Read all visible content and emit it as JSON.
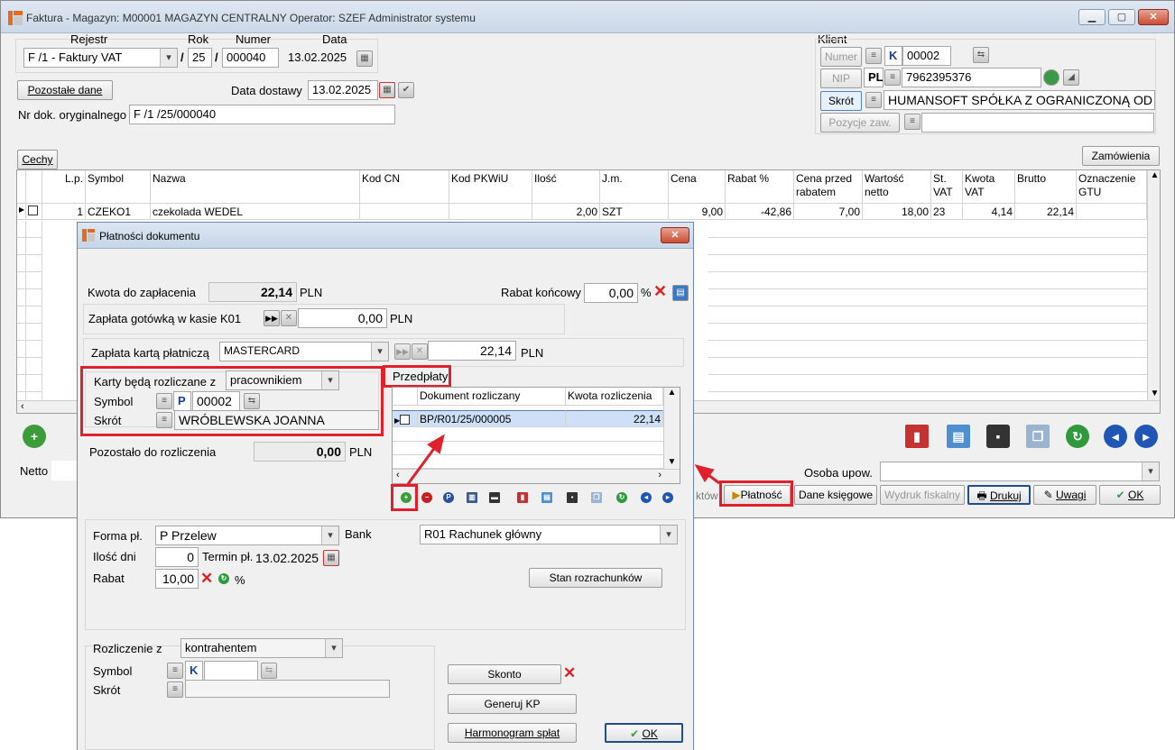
{
  "window": {
    "title": "Faktura - Magazyn: M00001 MAGAZYN CENTRALNY  Operator: SZEF Administrator systemu"
  },
  "header": {
    "rejestr_label": "Rejestr",
    "rok_label": "Rok",
    "numer_label": "Numer",
    "data_label": "Data",
    "rejestr": "F /1  - Faktury VAT",
    "rok": "25",
    "numer": "000040",
    "data": "13.02.2025",
    "pozostale_dane": "Pozostałe dane",
    "data_dostawy_label": "Data dostawy",
    "data_dostawy": "13.02.2025",
    "nr_dok_label": "Nr dok. oryginalnego",
    "nr_dok": "F /1  /25/000040"
  },
  "klient": {
    "label": "Klient",
    "numer_btn": "Numer",
    "numer_prefix": "K",
    "numer": "00002",
    "nip_btn": "NIP",
    "nip_prefix": "PL",
    "nip": "7962395376",
    "skrot_btn": "Skrót",
    "skrot": "HUMANSOFT SPÓŁKA Z OGRANICZONĄ OD",
    "pozycje_btn": "Pozycje zaw."
  },
  "toolbar": {
    "cechy": "Cechy",
    "zamowienia": "Zamówienia"
  },
  "grid": {
    "columns": [
      "L.p.",
      "Symbol",
      "Nazwa",
      "Kod CN",
      "Kod PKWiU",
      "Ilość",
      "J.m.",
      "Cena",
      "Rabat %",
      "Cena przed rabatem",
      "Wartość netto",
      "St. VAT",
      "Kwota VAT",
      "Brutto",
      "Oznaczenie GTU"
    ],
    "row": {
      "lp": "1",
      "symbol": "CZEKO1",
      "nazwa": "czekolada WEDEL",
      "ilosc": "2,00",
      "jm": "SZT",
      "cena": "9,00",
      "rabat": "-42,86",
      "cena_przed": "7,00",
      "wartosc": "18,00",
      "st_vat": "23",
      "kwota_vat": "4,14",
      "brutto": "22,14"
    }
  },
  "footer": {
    "netto_label": "Netto",
    "osoba_label": "Osoba upow.",
    "ktow": "któw",
    "platnosc": "Płatność",
    "dane_ksiegowe": "Dane księgowe",
    "wydruk": "Wydruk fiskalny",
    "drukuj": "Drukuj",
    "uwagi": "Uwagi",
    "ok": "OK"
  },
  "dialog": {
    "title": "Płatności dokumentu",
    "kwota_label": "Kwota do zapłacenia",
    "kwota": "22,14",
    "waluta": "PLN",
    "rabat_label": "Rabat końcowy",
    "rabat": "0,00",
    "pct": "%",
    "gotowka_label": "Zapłata gotówką w kasie K01",
    "gotowka": "0,00",
    "karta_label": "Zapłata kartą płatniczą",
    "karta_typ": "MASTERCARD",
    "karta": "22,14",
    "karty_label": "Karty będą rozliczane z",
    "karty_z": "pracownikiem",
    "symbol_label": "Symbol",
    "symbol_prefix": "P",
    "symbol": "00002",
    "skrot_label": "Skrót",
    "skrot": "WRÓBLEWSKA JOANNA",
    "pozostalo_label": "Pozostało do rozliczenia",
    "pozostalo": "0,00",
    "przedplaty": "Przedpłaty",
    "col_dok": "Dokument rozliczany",
    "col_kwota": "Kwota rozliczenia",
    "dok": "BP/R01/25/000005",
    "dok_kwota": "22,14"
  },
  "panel": {
    "forma_label": "Forma pł.",
    "forma": "P  Przelew",
    "bank_label": "Bank",
    "bank": "R01 Rachunek główny",
    "ilosc_dni_label": "Ilość dni",
    "ilosc_dni": "0",
    "termin_label": "Termin pł.",
    "termin": "13.02.2025",
    "rabat_label": "Rabat",
    "rabat": "10,00",
    "pct": "%",
    "stan": "Stan rozrachunków",
    "rozliczenie_label": "Rozliczenie z",
    "rozliczenie": "kontrahentem",
    "symbol_label": "Symbol",
    "symbol_prefix": "K",
    "skrot_label": "Skrót",
    "skonto": "Skonto",
    "generuj": "Generuj KP",
    "harmonogram": "Harmonogram spłat",
    "ok": "OK"
  },
  "colors": {
    "highlight": "#e0202a",
    "selection": "#cde0f7"
  }
}
